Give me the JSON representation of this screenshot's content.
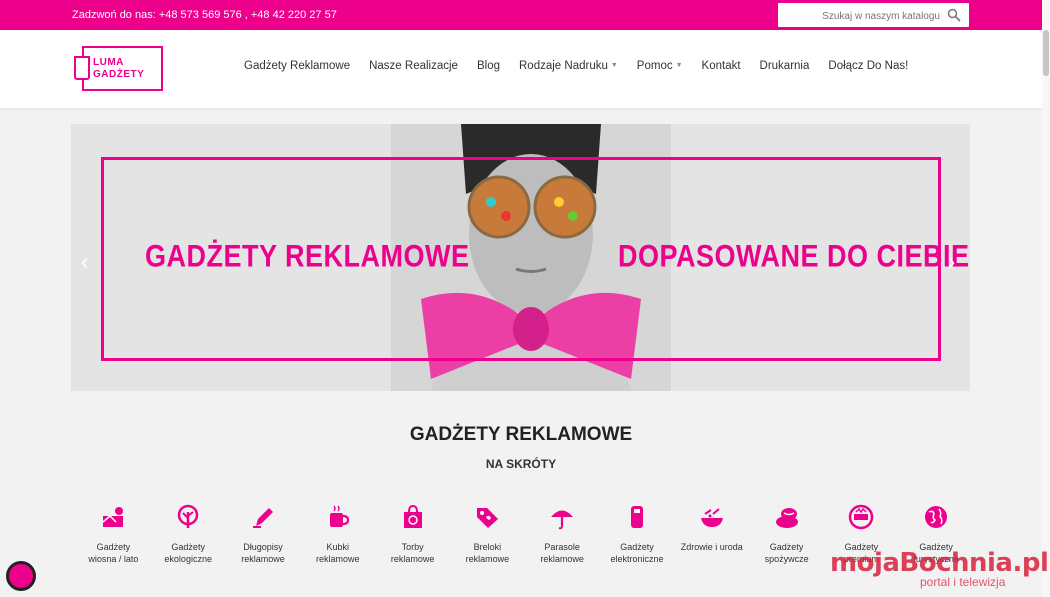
{
  "topbar": {
    "phone": "Zadzwoń do nas: +48 573 569 576 , +48 42 220 27 57",
    "search_placeholder": "Szukaj w naszym katalogu"
  },
  "logo": {
    "line1": "LUMA",
    "line2": "GADŻETY"
  },
  "nav": {
    "items": [
      {
        "label": "Gadżety Reklamowe",
        "has_dropdown": false
      },
      {
        "label": "Nasze Realizacje",
        "has_dropdown": false
      },
      {
        "label": "Blog",
        "has_dropdown": false
      },
      {
        "label": "Rodzaje Nadruku",
        "has_dropdown": true
      },
      {
        "label": "Pomoc",
        "has_dropdown": true
      },
      {
        "label": "Kontakt",
        "has_dropdown": false
      },
      {
        "label": "Drukarnia",
        "has_dropdown": false
      },
      {
        "label": "Dołącz Do Nas!",
        "has_dropdown": false
      }
    ]
  },
  "slider": {
    "text_left": "GADŻETY REKLAMOWE",
    "text_right": "DOPASOWANE DO CIEBIE",
    "prev": "‹",
    "next": "›"
  },
  "section": {
    "title": "GADŻETY REKLAMOWE",
    "subtitle": "NA SKRÓTY"
  },
  "categories": [
    {
      "line1": "Gadżety",
      "line2": "wiosna / lato",
      "icon": "summer-icon"
    },
    {
      "line1": "Gadżety",
      "line2": "ekologiczne",
      "icon": "tree-icon"
    },
    {
      "line1": "Długopisy",
      "line2": "reklamowe",
      "icon": "pen-icon"
    },
    {
      "line1": "Kubki",
      "line2": "reklamowe",
      "icon": "mug-icon"
    },
    {
      "line1": "Torby",
      "line2": "reklamowe",
      "icon": "bag-icon"
    },
    {
      "line1": "Breloki",
      "line2": "reklamowe",
      "icon": "tag-icon"
    },
    {
      "line1": "Parasole",
      "line2": "reklamowe",
      "icon": "umbrella-icon"
    },
    {
      "line1": "Gadżety",
      "line2": "elektroniczne",
      "icon": "usb-icon"
    },
    {
      "line1": "Zdrowie i uroda",
      "line2": "",
      "icon": "health-icon"
    },
    {
      "line1": "Gadżety",
      "line2": "spożywcze",
      "icon": "food-icon"
    },
    {
      "line1": "Gadżety",
      "line2": "premium",
      "icon": "premium-icon"
    },
    {
      "line1": "Gadżety",
      "line2": "turystyczne",
      "icon": "globe-icon"
    }
  ],
  "watermark": {
    "brand": "mojaBochnia.pl",
    "tagline": "portal i telewizja"
  },
  "colors": {
    "accent": "#ec008c",
    "text": "#333333"
  }
}
